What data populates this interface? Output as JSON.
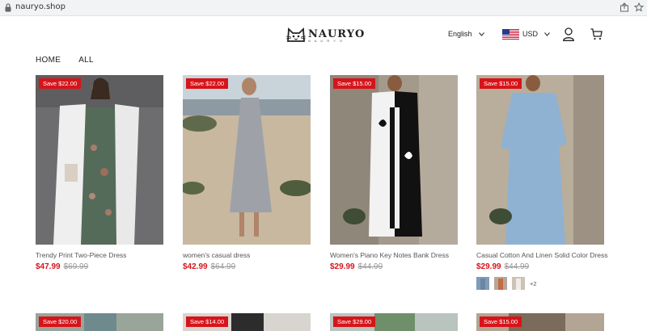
{
  "browser": {
    "url": "nauryo.shop"
  },
  "header": {
    "brand": "NAURYO",
    "brand_sub": "N A U R Y O",
    "language": "English",
    "currency": "USD"
  },
  "nav": {
    "items": [
      "HOME",
      "ALL"
    ]
  },
  "products": [
    {
      "badge": "Save $22.00",
      "title": "Trendy Print Two-Piece Dress",
      "price": "$47.99",
      "compare": "$69.99"
    },
    {
      "badge": "Save $22.00",
      "title": "women's casual dress",
      "price": "$42.99",
      "compare": "$64.99"
    },
    {
      "badge": "Save $15.00",
      "title": "Women's Piano Key Notes Bank Dress",
      "price": "$29.99",
      "compare": "$44.99"
    },
    {
      "badge": "Save $15.00",
      "title": "Casual Cotton And Linen Solid Color Dress",
      "price": "$29.99",
      "compare": "$44.99",
      "more_swatches": "+2"
    }
  ],
  "products_row2": [
    {
      "badge": "Save $20.00"
    },
    {
      "badge": "Save $14.00"
    },
    {
      "badge": "Save $29.00"
    },
    {
      "badge": "Save $15.00"
    }
  ],
  "colors": {
    "sale": "#d7141a",
    "text": "#222222"
  }
}
